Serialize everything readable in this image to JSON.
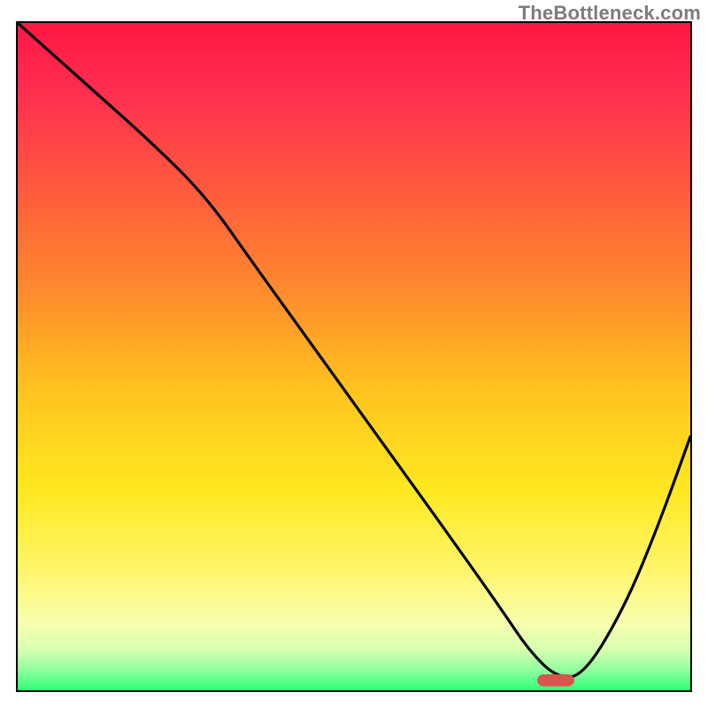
{
  "watermark": "TheBottleneck.com",
  "chart_data": {
    "type": "line",
    "title": "",
    "xlabel": "",
    "ylabel": "",
    "xlim": [
      0,
      100
    ],
    "ylim": [
      0,
      100
    ],
    "grid": false,
    "legend": false,
    "notes": "Gradient-background bottleneck curve. X-axis represents relative hardware balance; Y represents bottleneck severity (higher = worse). Values are estimated from the curve shape; no numeric axis ticks are shown in the image.",
    "series": [
      {
        "name": "bottleneck-curve",
        "color": "#000000",
        "x": [
          0,
          10,
          20,
          28,
          35,
          45,
          55,
          65,
          72,
          76,
          80,
          84,
          90,
          95,
          100
        ],
        "y": [
          100,
          91,
          82,
          74,
          64,
          50,
          36,
          22,
          12,
          6,
          2,
          2,
          12,
          24,
          38
        ]
      }
    ],
    "marker": {
      "name": "optimal-point",
      "color": "#d9534f",
      "x": 80,
      "y": 1.5,
      "width_pct": 5.5,
      "height_pct": 1.8
    },
    "background_gradient": {
      "stops": [
        {
          "offset": 0.0,
          "color": "#ff1744"
        },
        {
          "offset": 0.1,
          "color": "#ff2d4f"
        },
        {
          "offset": 0.25,
          "color": "#ff5a3d"
        },
        {
          "offset": 0.4,
          "color": "#ff8a2d"
        },
        {
          "offset": 0.55,
          "color": "#ffc31f"
        },
        {
          "offset": 0.7,
          "color": "#ffe81f"
        },
        {
          "offset": 0.82,
          "color": "#fff56b"
        },
        {
          "offset": 0.9,
          "color": "#f7ffb0"
        },
        {
          "offset": 0.94,
          "color": "#d6ffb0"
        },
        {
          "offset": 0.97,
          "color": "#8fff9f"
        },
        {
          "offset": 1.0,
          "color": "#2eff76"
        }
      ]
    }
  }
}
